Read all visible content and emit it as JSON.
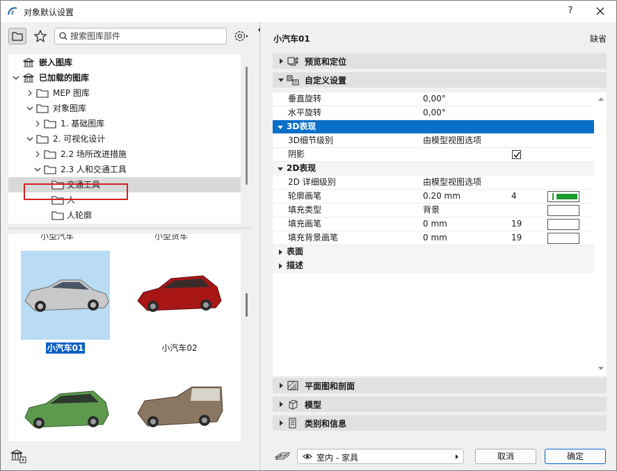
{
  "window": {
    "title": "对象默认设置",
    "help_label": "?"
  },
  "left": {
    "search_placeholder": "搜索图库部件",
    "tree": [
      {
        "label": "嵌入图库",
        "bold": true
      },
      {
        "label": "已加载的图库",
        "bold": true
      },
      {
        "label": "MEP 图库"
      },
      {
        "label": "对象图库"
      },
      {
        "label": "1. 基础图库"
      },
      {
        "label": "2. 可视化设计"
      },
      {
        "label": "2.2 场所改进措施"
      },
      {
        "label": "2.3 人和交通工具"
      },
      {
        "label": "交通工具"
      },
      {
        "label": "人"
      },
      {
        "label": "人轮廓"
      }
    ],
    "gallery_cut_labels": [
      "小型汽车",
      "小型货车"
    ],
    "gallery": [
      {
        "label": "小汽车01",
        "selected": true
      },
      {
        "label": "小汽车02",
        "selected": false
      },
      {
        "label": "",
        "selected": false
      },
      {
        "label": "",
        "selected": false
      }
    ],
    "car_colors": [
      "#c9c9c9",
      "#a81616",
      "#5e9a4e",
      "#8a7762"
    ]
  },
  "right": {
    "object_name": "小汽车01",
    "default_label": "缺省",
    "sections_top": [
      {
        "label": "预览和定位",
        "expanded": false
      },
      {
        "label": "自定义设置",
        "expanded": true
      }
    ],
    "properties": {
      "rotation_vertical": {
        "name": "垂直旋转",
        "value": "0,00°"
      },
      "rotation_horizontal": {
        "name": "水平旋转",
        "value": "0,00°"
      },
      "group_3d": "3D表现",
      "detail_3d": {
        "name": "3D细节级别",
        "value": "由模型视图选项"
      },
      "shadow": {
        "name": "阴影",
        "checked": true
      },
      "group_2d": "2D表现",
      "detail_2d": {
        "name": "2D 详细级别",
        "value": "由模型视图选项"
      },
      "contour_pen": {
        "name": "轮廓画笔",
        "value": "0.20 mm",
        "pen": "4"
      },
      "fill_type": {
        "name": "填充类型",
        "value": "背景"
      },
      "fill_pen": {
        "name": "填充画笔",
        "value": "0 mm",
        "pen": "19"
      },
      "fill_bg_pen": {
        "name": "填充背景画笔",
        "value": "0 mm",
        "pen": "19"
      },
      "group_surface": "表面",
      "group_desc": "描述"
    },
    "sections_bottom": [
      {
        "label": "平面图和剖面"
      },
      {
        "label": "模型"
      },
      {
        "label": "类别和信息"
      }
    ],
    "layer_value": "室内 - 家具",
    "cancel_label": "取消",
    "ok_label": "确定",
    "accent_color": "#0a6fc8"
  }
}
